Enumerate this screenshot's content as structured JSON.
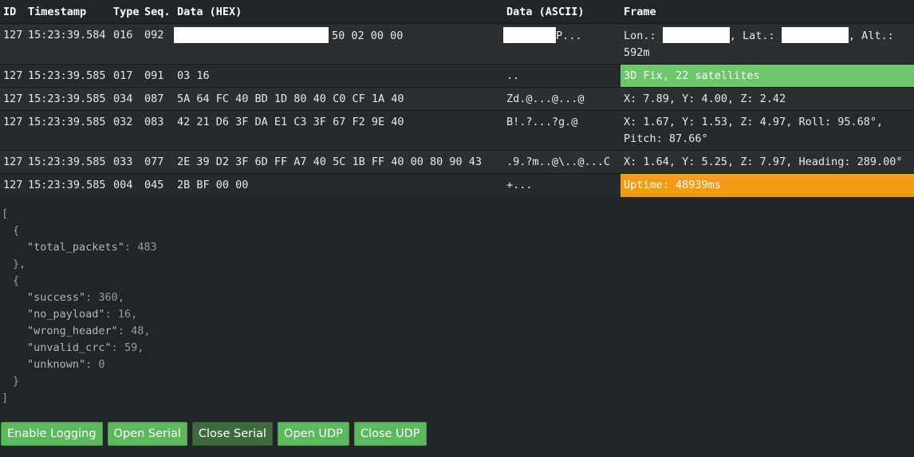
{
  "columns": {
    "id": "ID",
    "timestamp": "Timestamp",
    "type": "Type",
    "seq": "Seq.",
    "data_hex": "Data (HEX)",
    "data_ascii": "Data (ASCII)",
    "frame": "Frame"
  },
  "rows": [
    {
      "id": "127",
      "timestamp": "15:23:39.584",
      "type": "016",
      "seq": "092",
      "hex": "50 02 00 00",
      "ascii": "P...",
      "frame_lon_label": "Lon.:",
      "frame_lat_label": ", Lat.:",
      "frame_alt_label": ", Alt.:",
      "frame_alt_value": "592m"
    },
    {
      "id": "127",
      "timestamp": "15:23:39.585",
      "type": "017",
      "seq": "091",
      "hex": "03 16",
      "ascii": "..",
      "frame": "3D Fix, 22 satellites",
      "frame_color": "#6cc66b"
    },
    {
      "id": "127",
      "timestamp": "15:23:39.585",
      "type": "034",
      "seq": "087",
      "hex": "5A 64 FC 40 BD 1D 80 40 C0 CF 1A 40",
      "ascii": "Zd.@...@...@",
      "frame": "X: 7.89, Y: 4.00, Z: 2.42"
    },
    {
      "id": "127",
      "timestamp": "15:23:39.585",
      "type": "032",
      "seq": "083",
      "hex": "42 21 D6 3F DA E1 C3 3F 67 F2 9E 40",
      "ascii": "B!.?...?g.@",
      "frame": "X: 1.67, Y: 1.53, Z: 4.97, Roll: 95.68°, Pitch: 87.66°"
    },
    {
      "id": "127",
      "timestamp": "15:23:39.585",
      "type": "033",
      "seq": "077",
      "hex": "2E 39 D2 3F 6D FF A7 40 5C 1B FF 40 00 80 90 43",
      "ascii": ".9.?m..@\\..@...C",
      "frame": "X: 1.64, Y: 5.25, Z: 7.97, Heading: 289.00°"
    },
    {
      "id": "127",
      "timestamp": "15:23:39.585",
      "type": "004",
      "seq": "045",
      "hex": "2B BF 00 00",
      "ascii": "+...",
      "frame": "Uptime: 48939ms",
      "frame_color": "#f29b13"
    }
  ],
  "stats": {
    "open_bracket": "[",
    "close_bracket": "]",
    "open_brace": "{",
    "close_brace_comma": "},",
    "close_brace": "}",
    "total_packets_key": "\"total_packets\"",
    "total_packets_value": "483",
    "success_key": "\"success\"",
    "success_value": "360",
    "no_payload_key": "\"no_payload\"",
    "no_payload_value": "16",
    "wrong_header_key": "\"wrong_header\"",
    "wrong_header_value": "48",
    "unvalid_crc_key": "\"unvalid_crc\"",
    "unvalid_crc_value": "59",
    "unknown_key": "\"unknown\"",
    "unknown_value": "0"
  },
  "buttons": {
    "enable_logging": "Enable Logging",
    "open_serial": "Open Serial",
    "close_serial": "Close Serial",
    "open_udp": "Open UDP",
    "close_udp": "Close UDP"
  },
  "colors": {
    "background": "#212527",
    "button_green": "#5cb85c",
    "button_active": "#3e6b3e",
    "frame_green": "#6cc66b",
    "frame_orange": "#f29b13"
  }
}
